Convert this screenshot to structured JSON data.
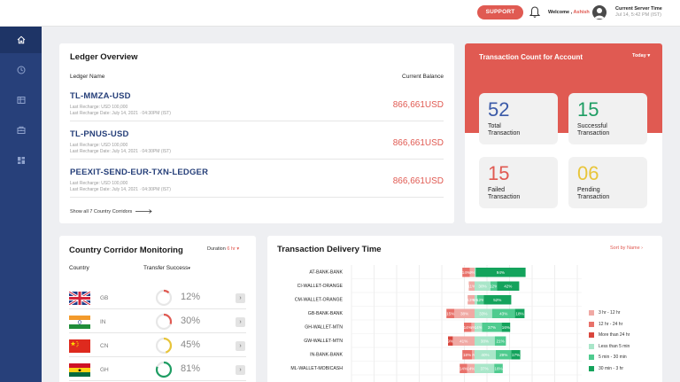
{
  "header": {
    "support_label": "SUPPORT",
    "welcome_prefix": "Welcome ,",
    "user_name": "Ashish",
    "server_time_label": "Current Server Time",
    "server_time_value": "Jul 14, 5:42 PM (IST)"
  },
  "sidebar": {
    "items": [
      {
        "icon": "home-icon",
        "active": true
      },
      {
        "icon": "clock-icon",
        "active": false
      },
      {
        "icon": "ledger-icon",
        "active": false
      },
      {
        "icon": "wallet-icon",
        "active": false
      },
      {
        "icon": "dashboard-icon",
        "active": false
      }
    ]
  },
  "ledger": {
    "title": "Ledger Overview",
    "col_name": "Ledger Name",
    "col_balance": "Current Balance",
    "rows": [
      {
        "name": "TL-MMZA-USD",
        "last_recharge": "Last Recharge: USD 100,000",
        "last_recharge_date": "Last Recharge Date: July 14, 2021 · 04:30PM (IST)",
        "balance": "866,661USD"
      },
      {
        "name": "TL-PNUS-USD",
        "last_recharge": "Last Recharge: USD 100,000",
        "last_recharge_date": "Last Recharge Date: July 14, 2021 · 04:30PM (IST)",
        "balance": "866,661USD"
      },
      {
        "name": "PEEXIT-SEND-EUR-TXN-LEDGER",
        "last_recharge": "Last Recharge: USD 100,000",
        "last_recharge_date": "Last Recharge Date: July 14, 2021 · 04:30PM (IST)",
        "balance": "866,661USD"
      }
    ],
    "show_all": "Show all  7 Country Corridors"
  },
  "txn_count": {
    "title": "Transaction Count for Account",
    "period": "Today",
    "tiles": [
      {
        "value": "52",
        "label1": "Total",
        "label2": "Transaction",
        "color": "#3b5aa8"
      },
      {
        "value": "15",
        "label1": "Successful",
        "label2": "Transaction",
        "color": "#1e9d63"
      },
      {
        "value": "15",
        "label1": "Failed",
        "label2": "Transaction",
        "color": "#e05a52"
      },
      {
        "value": "06",
        "label1": "Pending",
        "label2": "Transaction",
        "color": "#e8c53a"
      }
    ]
  },
  "corridor": {
    "title": "Country Corridor Monitoring",
    "duration_label": "Duration",
    "duration_value": "6 hr",
    "col_country": "Country",
    "col_success": "Transfer Success",
    "rows": [
      {
        "code": "GB",
        "flag": "gb-flag",
        "percent": "12%",
        "fraction": 0.12,
        "color": "#e05a52"
      },
      {
        "code": "IN",
        "flag": "india-flag",
        "percent": "30%",
        "fraction": 0.3,
        "color": "#e05a52"
      },
      {
        "code": "CN",
        "flag": "china-flag",
        "percent": "45%",
        "fraction": 0.45,
        "color": "#e8c53a"
      },
      {
        "code": "GH",
        "flag": "ghana-flag",
        "percent": "81%",
        "fraction": 0.81,
        "color": "#1e9d63"
      }
    ]
  },
  "delivery": {
    "title": "Transaction Delivery Time",
    "sort_label": "Sort by",
    "sort_value": "Name",
    "legend": [
      {
        "label": "3 hr - 12 hr",
        "color": "#f0a9a4"
      },
      {
        "label": "12 hr - 24 hr",
        "color": "#e8716a"
      },
      {
        "label": "More than 24 hr",
        "color": "#d9463d"
      },
      {
        "label": "Less than 5 min",
        "color": "#a9e6c9"
      },
      {
        "label": "5 min - 30 min",
        "color": "#4fcb8f"
      },
      {
        "label": "30 min - 3 hr",
        "color": "#14a35c"
      }
    ]
  },
  "chart_data": {
    "type": "bar",
    "stacked": true,
    "diverging": true,
    "categories": [
      "AT-BANK-BANK",
      "CI-WALLET-ORANGE",
      "CM-WALLET-ORANGE",
      "GB-BANK-BANK",
      "GH-WALLET-MTN",
      "GW-WALLET-MTN",
      "IN-BANK-BANK",
      "ML-WALLET-MOBICASH"
    ],
    "negative_series": [
      {
        "name": "More than 24 hr",
        "color": "#d9463d",
        "values": [
          0,
          0,
          0,
          0,
          0,
          9,
          0,
          0
        ],
        "labels": [
          "",
          "",
          "",
          "",
          "",
          "9%",
          "",
          ""
        ]
      },
      {
        "name": "12 hr - 24 hr",
        "color": "#e8716a",
        "values": [
          14,
          0,
          0,
          15,
          14,
          0,
          18,
          14
        ],
        "labels": [
          "14%",
          "",
          "",
          "15%",
          "14%",
          "",
          "18%",
          "14%"
        ]
      },
      {
        "name": "3 hr - 12 hr",
        "color": "#f0a9a4",
        "values": [
          9,
          11,
          13,
          38,
          6,
          41,
          5,
          14
        ],
        "labels": [
          "9%",
          "11%",
          "13%",
          "38%",
          "6%",
          "41%",
          "5%",
          "14%"
        ]
      }
    ],
    "positive_series": [
      {
        "name": "Less than 5 min",
        "color": "#a9e6c9",
        "values": [
          2,
          30,
          5,
          33,
          14,
          38,
          40,
          37
        ],
        "labels": [
          "",
          "30%",
          "5%",
          "33%",
          "14%",
          "38%",
          "40%",
          "37%"
        ]
      },
      {
        "name": "5 min - 30 min",
        "color": "#4fcb8f",
        "values": [
          0,
          12,
          12,
          43,
          37,
          21,
          29,
          16
        ],
        "labels": [
          "",
          "12%",
          "12%",
          "43%",
          "37%",
          "21%",
          "29%",
          "16%"
        ]
      },
      {
        "name": "30 min - 3 hr",
        "color": "#14a35c",
        "values": [
          94,
          42,
          52,
          18,
          16,
          0,
          17,
          0
        ],
        "labels": [
          "94%",
          "42%",
          "52%",
          "18%",
          "16%",
          "",
          "17%",
          ""
        ]
      }
    ]
  }
}
